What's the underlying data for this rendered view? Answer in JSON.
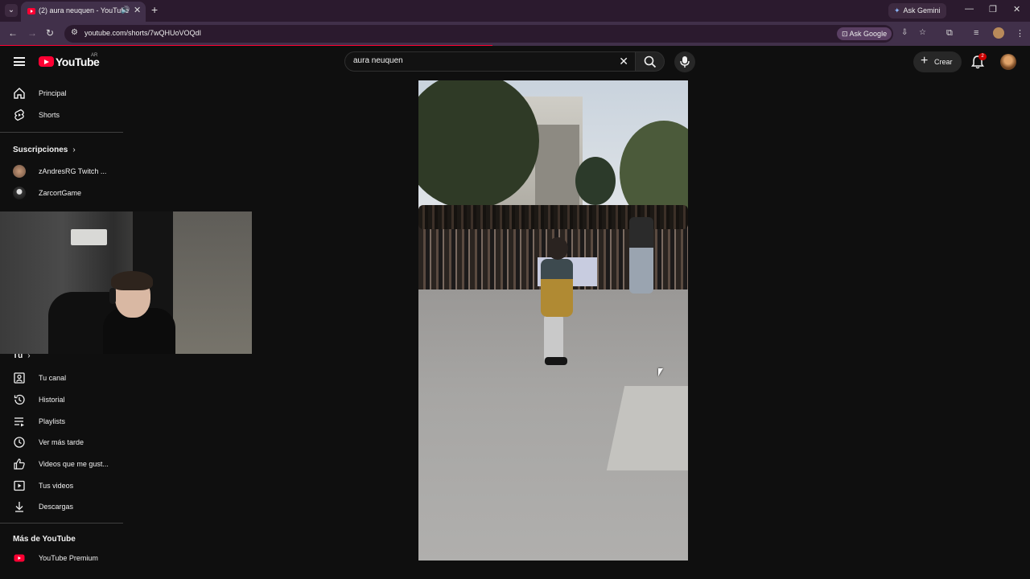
{
  "browser": {
    "tab_title": "(2) aura neuquen - YouTube",
    "url": "youtube.com/shorts/7wQHUoVOQdI",
    "ask_gemini": "Ask Gemini",
    "ask_google": "Ask Google"
  },
  "header": {
    "logo_text": "YouTube",
    "logo_region": "AR",
    "search_value": "aura neuquen",
    "create_label": "Crear",
    "notification_count": "2"
  },
  "sidebar": {
    "main": [
      {
        "label": "Principal",
        "icon": "home-icon"
      },
      {
        "label": "Shorts",
        "icon": "shorts-icon"
      }
    ],
    "subscriptions_title": "Suscripciones",
    "subscriptions": [
      {
        "label": "zAndresRG Twitch ..."
      },
      {
        "label": "ZarcortGame"
      }
    ],
    "you_title": "Tú",
    "you_items": [
      {
        "label": "Tu canal",
        "icon": "channel-icon"
      },
      {
        "label": "Historial",
        "icon": "history-icon"
      },
      {
        "label": "Playlists",
        "icon": "playlists-icon"
      },
      {
        "label": "Ver más tarde",
        "icon": "watch-later-icon"
      },
      {
        "label": "Videos que me gust...",
        "icon": "liked-icon"
      },
      {
        "label": "Tus videos",
        "icon": "your-videos-icon"
      },
      {
        "label": "Descargas",
        "icon": "downloads-icon"
      }
    ],
    "more_title": "Más de YouTube",
    "more_items": [
      {
        "label": "YouTube Premium",
        "icon": "youtube-premium-icon"
      }
    ]
  },
  "colors": {
    "brand_red": "#ff0033",
    "chrome_dark": "#2b1a2e",
    "chrome_mid": "#41304a",
    "page_bg": "#0f0f0f"
  }
}
